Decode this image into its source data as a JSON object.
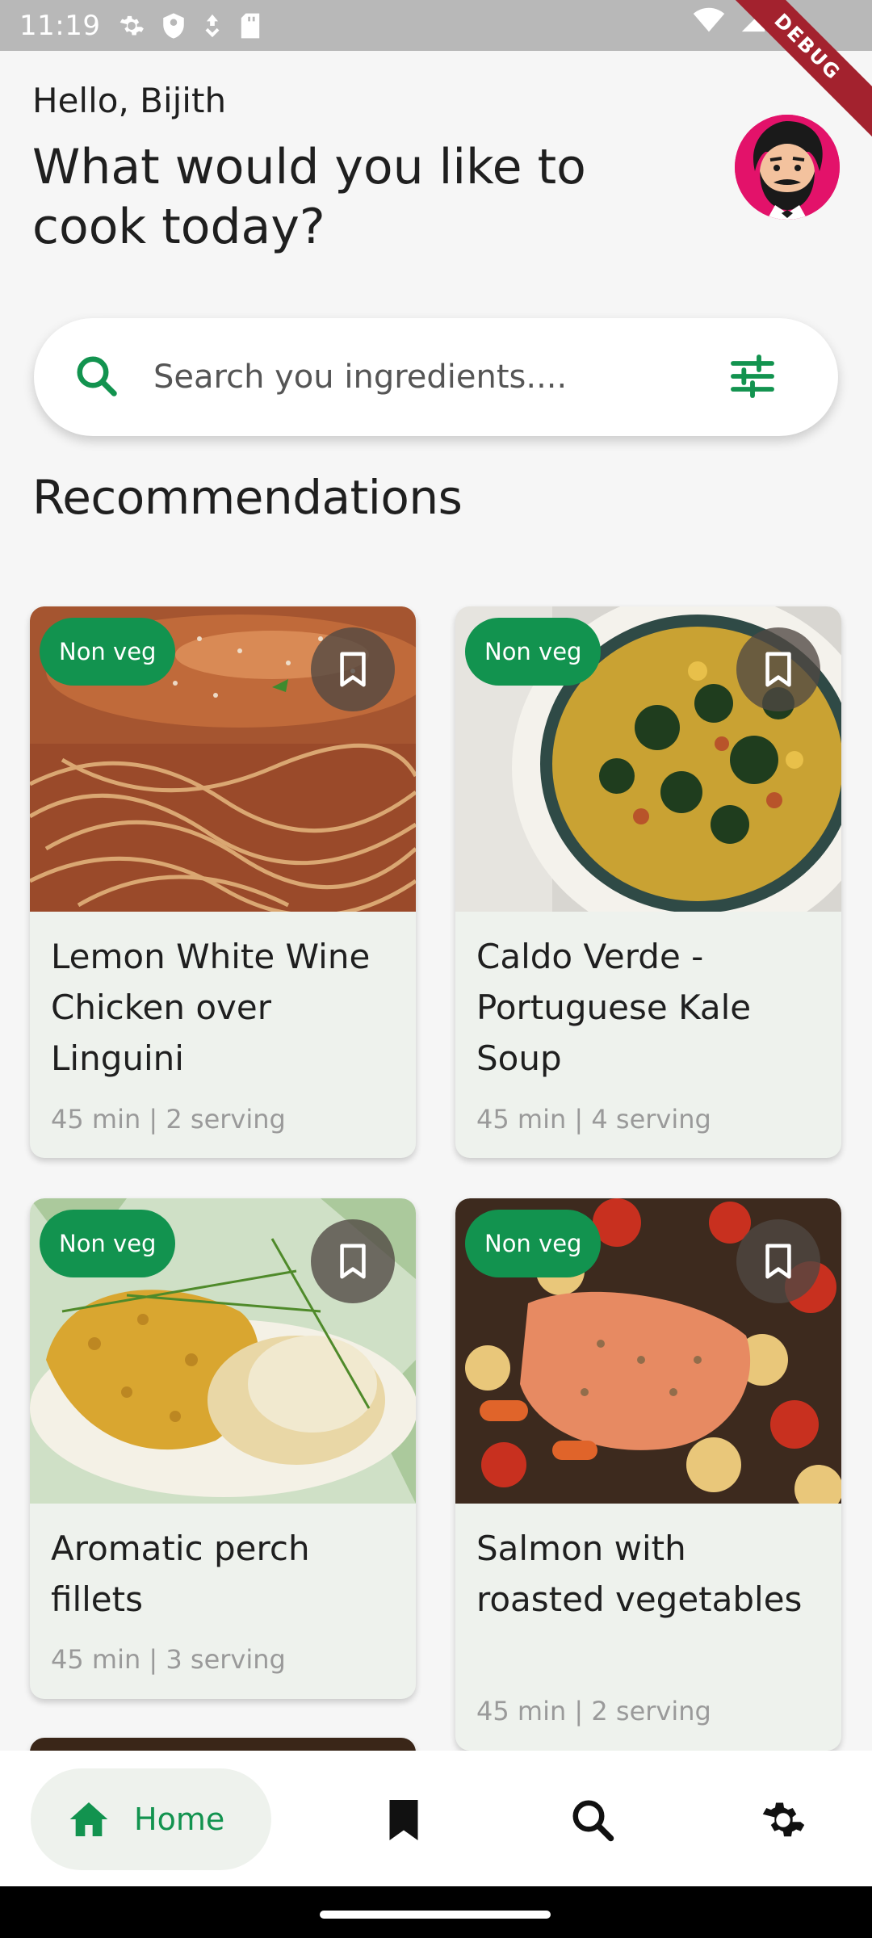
{
  "status_bar": {
    "time": "11:19",
    "icons_left": [
      "settings-icon",
      "shield-icon",
      "location-icon",
      "sd-card-icon"
    ],
    "icons_right": [
      "wifi-icon",
      "signal-icon",
      "battery-icon"
    ],
    "debug_label": "DEBUG"
  },
  "header": {
    "greeting": "Hello, Bijith",
    "headline": "What would you like to cook today?",
    "avatar_icon": "avatar-cartoon-man"
  },
  "search": {
    "placeholder": "Search you ingredients....",
    "value": "",
    "accent": "#12934F"
  },
  "section": {
    "title": "Recommendations"
  },
  "recipes": [
    {
      "badge": "Non veg",
      "title": "Lemon White Wine Chicken over Linguini",
      "meta": "45 min | 2 serving",
      "image": "pasta-photo"
    },
    {
      "badge": "Non veg",
      "title": "Caldo Verde - Portuguese Kale Soup",
      "meta": "45 min | 4 serving",
      "image": "soup-photo"
    },
    {
      "badge": "Non veg",
      "title": "Aromatic perch fillets",
      "meta": "45 min | 3 serving",
      "image": "fish-photo"
    },
    {
      "badge": "Non veg",
      "title": "Salmon with roasted vegetables",
      "meta": "45 min | 2 serving",
      "image": "salmon-photo"
    }
  ],
  "nav": {
    "home_label": "Home",
    "items": [
      "home-icon",
      "bookmark-icon",
      "search-icon",
      "settings-icon"
    ],
    "active_color": "#12934F"
  }
}
